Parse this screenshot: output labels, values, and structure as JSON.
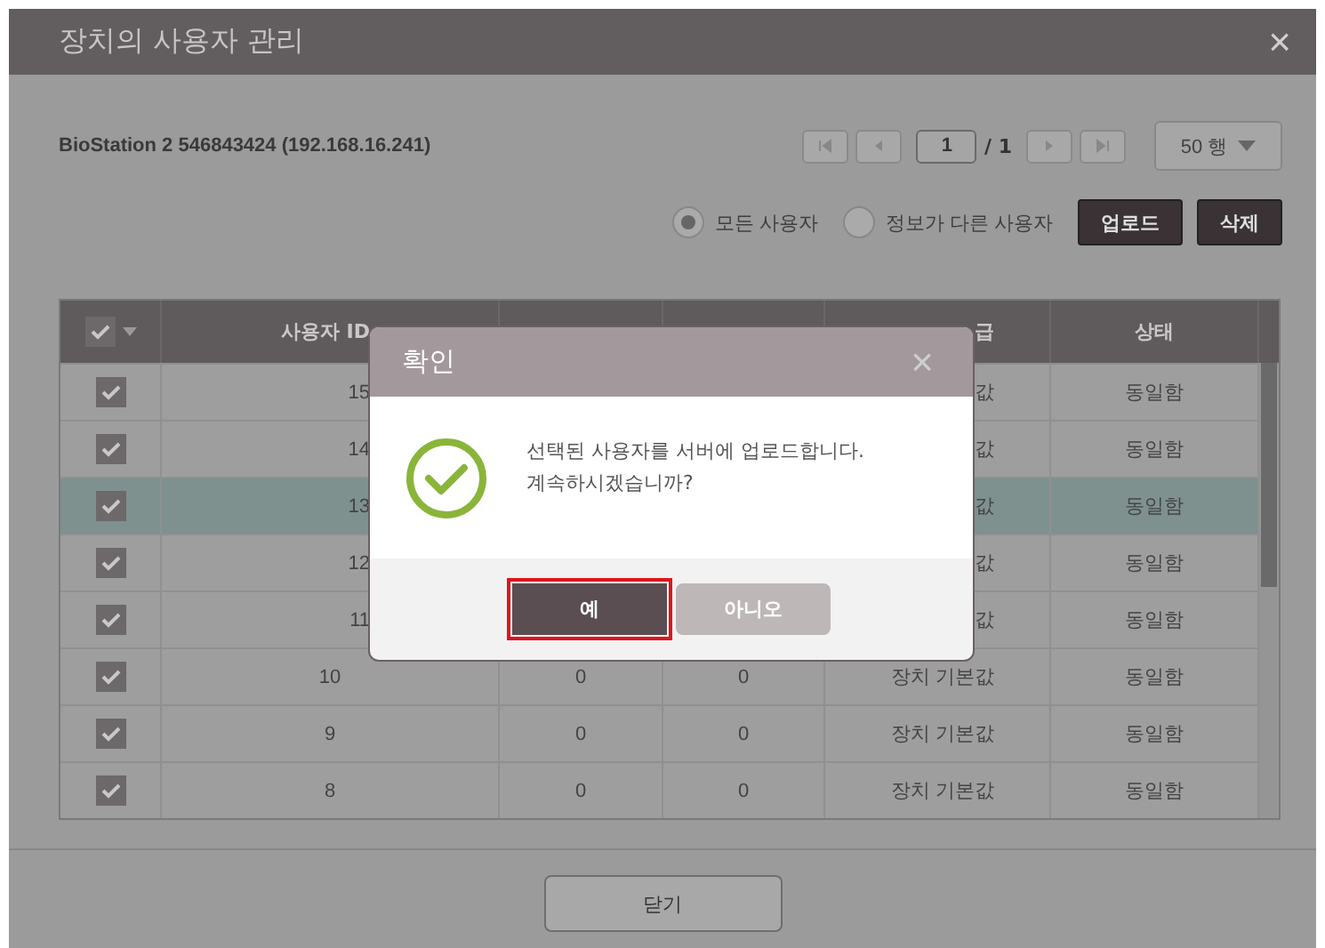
{
  "window": {
    "title": "장치의 사용자 관리",
    "close": "×"
  },
  "device": "BioStation 2 546843424 (192.168.16.241)",
  "pager": {
    "page": "1",
    "total": "/ 1",
    "rows_per_page": "50 행"
  },
  "filters": [
    {
      "label": "모든 사용자",
      "selected": true
    },
    {
      "label": "정보가 다른 사용자",
      "selected": false
    }
  ],
  "actions": [
    "업로드",
    "삭제"
  ],
  "table": {
    "header_checked": true,
    "columns": {
      "user_id": "사용자 ID",
      "column_5": "급",
      "status": "상태"
    },
    "rows": [
      {
        "checked": true,
        "selected": false,
        "user_id": "15",
        "column_5": "값",
        "status": "동일함"
      },
      {
        "checked": true,
        "selected": false,
        "user_id": "14",
        "column_5": "값",
        "status": "동일함"
      },
      {
        "checked": true,
        "selected": true,
        "user_id": "13",
        "column_5": "값",
        "status": "동일함"
      },
      {
        "checked": true,
        "selected": false,
        "user_id": "12",
        "column_5": "값",
        "status": "동일함"
      },
      {
        "checked": true,
        "selected": false,
        "user_id": "11",
        "column_5": "값",
        "status": "동일함"
      },
      {
        "checked": true,
        "selected": false,
        "user_id": "10",
        "column_3": "0",
        "column_4": "0",
        "column_5": "장치 기본값",
        "status": "동일함"
      },
      {
        "checked": true,
        "selected": false,
        "user_id": "9",
        "column_3": "0",
        "column_4": "0",
        "column_5": "장치 기본값",
        "status": "동일함"
      },
      {
        "checked": true,
        "selected": false,
        "user_id": "8",
        "column_3": "0",
        "column_4": "0",
        "column_5": "장치 기본값",
        "status": "동일함"
      }
    ]
  },
  "footer_button": "닫기",
  "confirm": {
    "title": "확인",
    "close": "×",
    "message": [
      "선택된 사용자를 서버에 업로드합니다.",
      "계속하시겠습니까?"
    ],
    "buttons": [
      {
        "label": "예",
        "kind": "primary",
        "selected": true
      },
      {
        "label": "아니오",
        "kind": "secondary",
        "selected": false
      }
    ]
  }
}
